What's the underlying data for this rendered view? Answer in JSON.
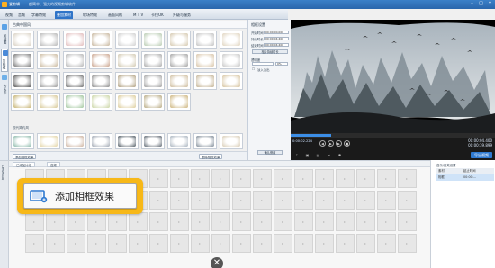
{
  "window": {
    "app_name": "爱剪辑",
    "tagline": "超简单、强大的视频剪辑软件"
  },
  "tabs": [
    {
      "label": "视频",
      "active": false
    },
    {
      "label": "音频",
      "active": false
    },
    {
      "label": "字幕特效",
      "active": false
    },
    {
      "label": "叠加素材",
      "active": true
    },
    {
      "label": "转场特效",
      "active": false
    },
    {
      "label": "画面风格",
      "active": false
    },
    {
      "label": "M T V",
      "active": false
    },
    {
      "label": "卡拉OK",
      "active": false
    },
    {
      "label": "升级与服务",
      "active": false
    }
  ],
  "sidebar": {
    "items": [
      {
        "label": "加贴图",
        "icon": "sticker-icon",
        "active": false
      },
      {
        "label": "加相框",
        "icon": "frame-icon",
        "active": true
      },
      {
        "label": "去水印",
        "icon": "watermark-icon",
        "active": false
      }
    ]
  },
  "category_label": "古典中国风",
  "separator_label": "现代简约风",
  "actions": {
    "add_frame": "添加相框效果",
    "delete_frame": "删除相框效果"
  },
  "settings": {
    "title": "相框设置",
    "start_label": "开始时间",
    "start_value": "00:00:00.000",
    "duration_label": "持续时长",
    "duration_value": "00:00:04.400",
    "end_label": "结束时间",
    "end_value": "00:00:04.400",
    "sync_button": "相片持续时长",
    "transparency_label": "透明度",
    "transparency_value": "0%",
    "fade_label": "淡入淡出",
    "confirm_button": "确认修改"
  },
  "player": {
    "current_time": "0:00:02.224",
    "time_total_a": "00:00:04.400",
    "time_total_b": "00:00:39.899",
    "export_label": "导出视频",
    "progress": 0.2
  },
  "timeline": {
    "side_label": "已添加片段",
    "tab_1": "已添加片段",
    "tab_2": "音频"
  },
  "right_panel": {
    "title": "音乐/音效设置",
    "col_1": "素材",
    "col_2": "起止时间",
    "row_name": "相框",
    "row_time": "00:00:..."
  },
  "callout": {
    "label": "添加相框效果"
  },
  "close_glyph": "✕"
}
